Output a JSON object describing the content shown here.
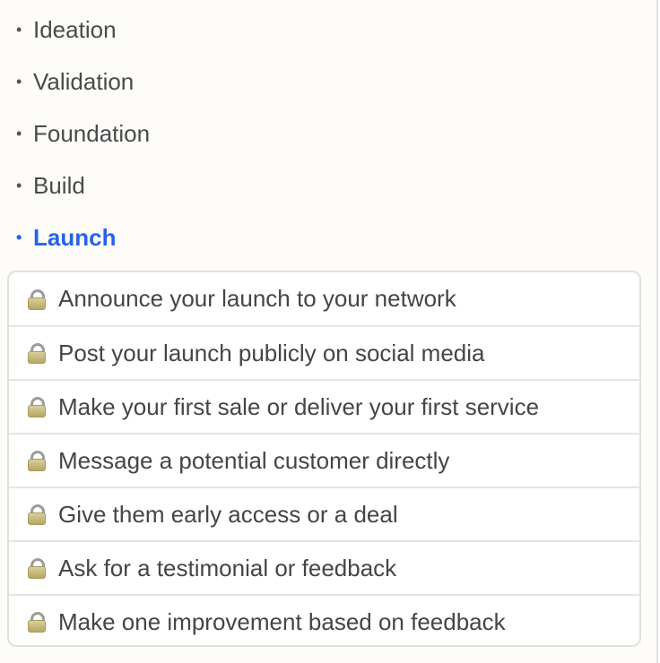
{
  "stages": [
    {
      "label": "Ideation",
      "active": false
    },
    {
      "label": "Validation",
      "active": false
    },
    {
      "label": "Foundation",
      "active": false
    },
    {
      "label": "Build",
      "active": false
    },
    {
      "label": "Launch",
      "active": true
    }
  ],
  "bullet": "•",
  "accent_color": "#2563eb",
  "task_icon": "lock-icon",
  "tasks": [
    {
      "label": "Announce your launch to your network",
      "locked": true
    },
    {
      "label": "Post your launch publicly on social media",
      "locked": true
    },
    {
      "label": "Make your first sale or deliver your first service",
      "locked": true
    },
    {
      "label": "Message a potential customer directly",
      "locked": true
    },
    {
      "label": "Give them early access or a deal",
      "locked": true
    },
    {
      "label": "Ask for a testimonial or feedback",
      "locked": true
    },
    {
      "label": "Make one improvement based on feedback",
      "locked": true
    }
  ]
}
